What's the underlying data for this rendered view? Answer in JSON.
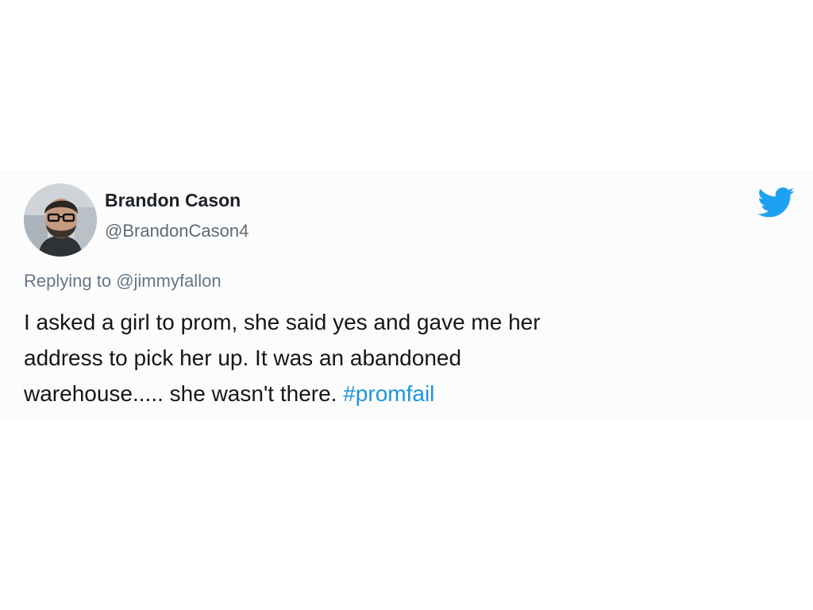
{
  "tweet": {
    "display_name": "Brandon Cason",
    "handle": "@BrandonCason4",
    "reply_prefix": "Replying to",
    "reply_mention": "@jimmyfallon",
    "body_lines": [
      "I asked a girl to prom, she said yes and gave me her",
      "address to pick her up. It was an abandoned",
      "warehouse..... she wasn't there."
    ],
    "hashtag": "#promfail",
    "avatar_icon": "user-avatar",
    "brand_icon": "twitter-bird-icon",
    "colors": {
      "hashtag": "#1b95e0",
      "bird": "#1da1f2",
      "secondary_text": "#657786",
      "primary_text": "#14171a"
    }
  }
}
